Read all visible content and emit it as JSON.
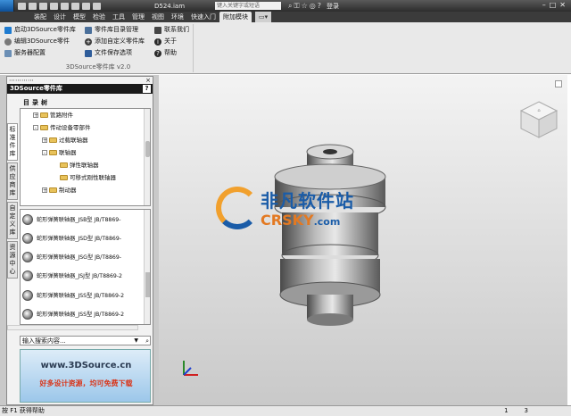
{
  "titlebar": {
    "doc_name": "D524.iam",
    "search_hint": "键入关键字或短语",
    "login": "登录",
    "icons": [
      "search-icon",
      "binoculars-icon",
      "key-icon",
      "star-icon",
      "globe-icon",
      "help-icon"
    ]
  },
  "menu": {
    "tabs": [
      "装配",
      "设计",
      "模型",
      "检验",
      "工具",
      "管理",
      "视图",
      "环境",
      "快速入门",
      "附加模块"
    ],
    "active": "附加模块"
  },
  "ribbon": {
    "group_title": "3DSource零件库 v2.0",
    "items": [
      {
        "label": "启动3DSource零件库",
        "icon": "launch-icon"
      },
      {
        "label": "编辑3DSource零件",
        "icon": "edit-icon"
      },
      {
        "label": "服务器配置",
        "icon": "server-icon"
      },
      {
        "label": "零件库目录管理",
        "icon": "catalog-icon"
      },
      {
        "label": "添加自定义零件库",
        "icon": "add-icon"
      },
      {
        "label": "文件保存选项",
        "icon": "save-icon"
      },
      {
        "label": "联系我们",
        "icon": "contact-icon"
      },
      {
        "label": "关于",
        "icon": "info-icon"
      },
      {
        "label": "帮助",
        "icon": "help-icon"
      }
    ]
  },
  "panel": {
    "title": "3DSource零件库",
    "help_label": "?",
    "close": "×",
    "side_tabs": [
      "标准件库",
      "供应商库",
      "自定义库",
      "资源中心"
    ],
    "tree_header": "目录树",
    "tree": [
      {
        "label": "管路附件",
        "level": 1,
        "expanded": false
      },
      {
        "label": "传动设备零部件",
        "level": 1,
        "expanded": true
      },
      {
        "label": "过载联轴器",
        "level": 2,
        "expanded": false
      },
      {
        "label": "联轴器",
        "level": 2,
        "expanded": true
      },
      {
        "label": "弹性联轴器",
        "level": 3,
        "expanded": false
      },
      {
        "label": "可移式刚性联轴器",
        "level": 3,
        "expanded": false
      },
      {
        "label": "制动器",
        "level": 2,
        "expanded": false
      }
    ],
    "parts": [
      "蛇形弹簧联轴器_JSB型 JB/T8869-",
      "蛇形弹簧联轴器_JSD型 JB/T8869-",
      "蛇形弹簧联轴器_JSG型 JB/T8869-",
      "蛇形弹簧联轴器_JSJ型 JB/T8869-2",
      "蛇形弹簧联轴器_JSS型 JB/T8869-2",
      "蛇形弹簧联轴器_JSS型 JB/T8869-2"
    ],
    "search_placeholder": "输入搜索内容...",
    "banner_url": "www.3DSource.cn",
    "banner_slogan": "好多设计资源，均可免费下载"
  },
  "watermark": {
    "cn": "非凡软件站",
    "en": "CRSKY",
    ".com": ".com"
  },
  "status": {
    "left": "按 F1 获得帮助",
    "right": [
      "1",
      "3"
    ]
  }
}
